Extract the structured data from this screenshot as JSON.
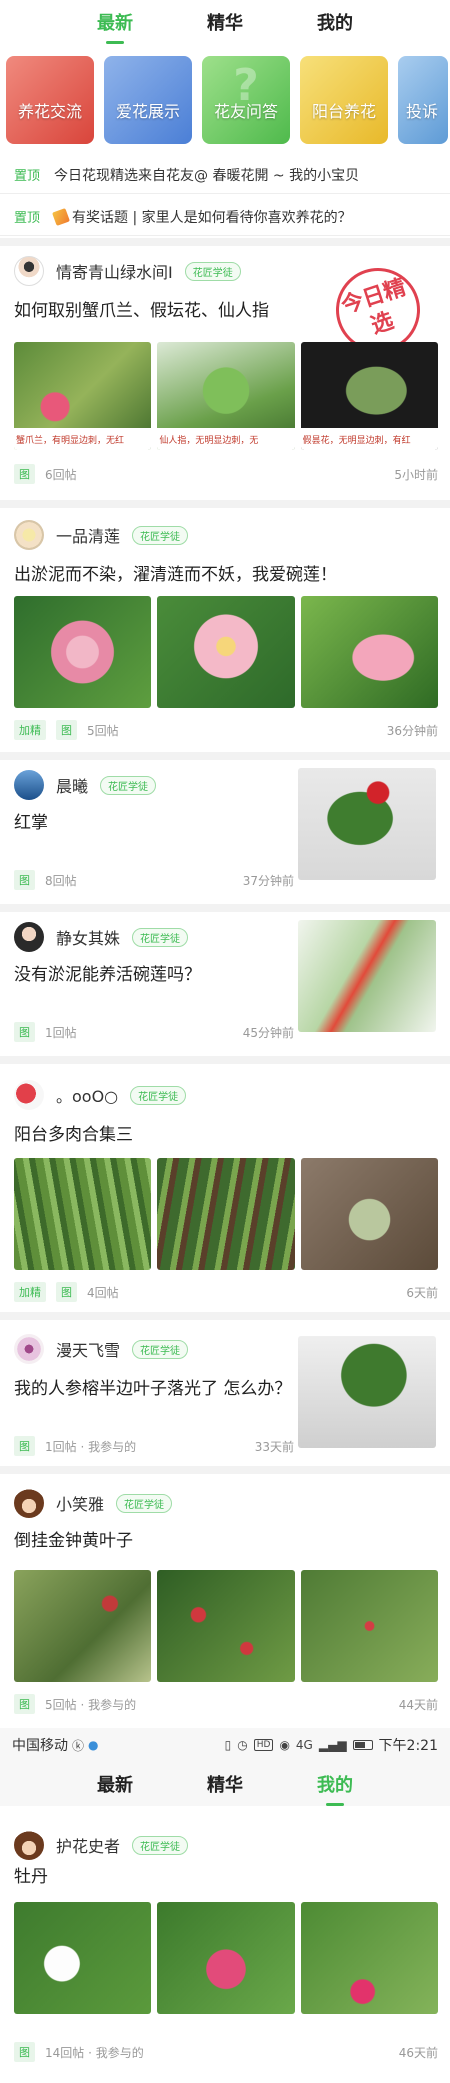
{
  "top_tabs": [
    "最新",
    "精华",
    "我的"
  ],
  "categories": [
    "养花交流",
    "爱花展示",
    "花友问答",
    "阳台养花",
    "投诉"
  ],
  "pinned": [
    {
      "tag": "置顶",
      "text": "今日花现精选来自花友@ 春暖花開 ~ 我的小宝贝"
    },
    {
      "tag": "置顶",
      "text": "有奖话题 | 家里人是如何看待你喜欢养花的？"
    }
  ],
  "stamp": "今日精选",
  "posts": [
    {
      "author": "情寄青山绿水间I",
      "badge": "花匠学徒",
      "title": "如何取别蟹爪兰、假坛花、仙人指",
      "captions": [
        "蟹爪兰，有明显边刺，无红",
        "仙人指，无明显边刺，无",
        "假昙花，无明显边刺，有红"
      ],
      "meta": [
        "图",
        "6回帖"
      ],
      "time": "5小时前"
    },
    {
      "author": "一品清莲",
      "badge": "花匠学徒",
      "title": "出淤泥而不染，濯清涟而不妖，我爱碗莲！",
      "meta": [
        "加精",
        "图",
        "5回帖"
      ],
      "time": "36分钟前"
    },
    {
      "author": "晨曦",
      "badge": "花匠学徒",
      "title": "红掌",
      "meta": [
        "图",
        "8回帖"
      ],
      "time": "37分钟前"
    },
    {
      "author": "静女其姝",
      "badge": "花匠学徒",
      "title": "没有淤泥能养活碗莲吗？",
      "meta": [
        "图",
        "1回帖"
      ],
      "time": "45分钟前"
    },
    {
      "author": "。ooO○",
      "badge": "花匠学徒",
      "title": "阳台多肉合集三",
      "meta": [
        "加精",
        "图",
        "4回帖"
      ],
      "time": "6天前"
    },
    {
      "author": "漫天飞雪",
      "badge": "花匠学徒",
      "title": "我的人参榕半边叶子落光了 怎么办？",
      "meta": [
        "图",
        "1回帖 · 我参与的"
      ],
      "time": "33天前"
    },
    {
      "author": "小笑雅",
      "badge": "花匠学徒",
      "title": "倒挂金钟黄叶子",
      "meta": [
        "图",
        "5回帖 · 我参与的"
      ],
      "time": "44天前"
    },
    {
      "author": "护花史者",
      "badge": "花匠学徒",
      "title": "牡丹",
      "meta": [
        "图",
        "14回帖 · 我参与的"
      ],
      "time": "46天前"
    }
  ],
  "statusbar": {
    "carrier": "中国移动",
    "time": "下午2:21",
    "hd": "HD",
    "signal": "4G"
  },
  "colors": {
    "accent": "#3dbb53",
    "stamp": "#e0414f"
  }
}
